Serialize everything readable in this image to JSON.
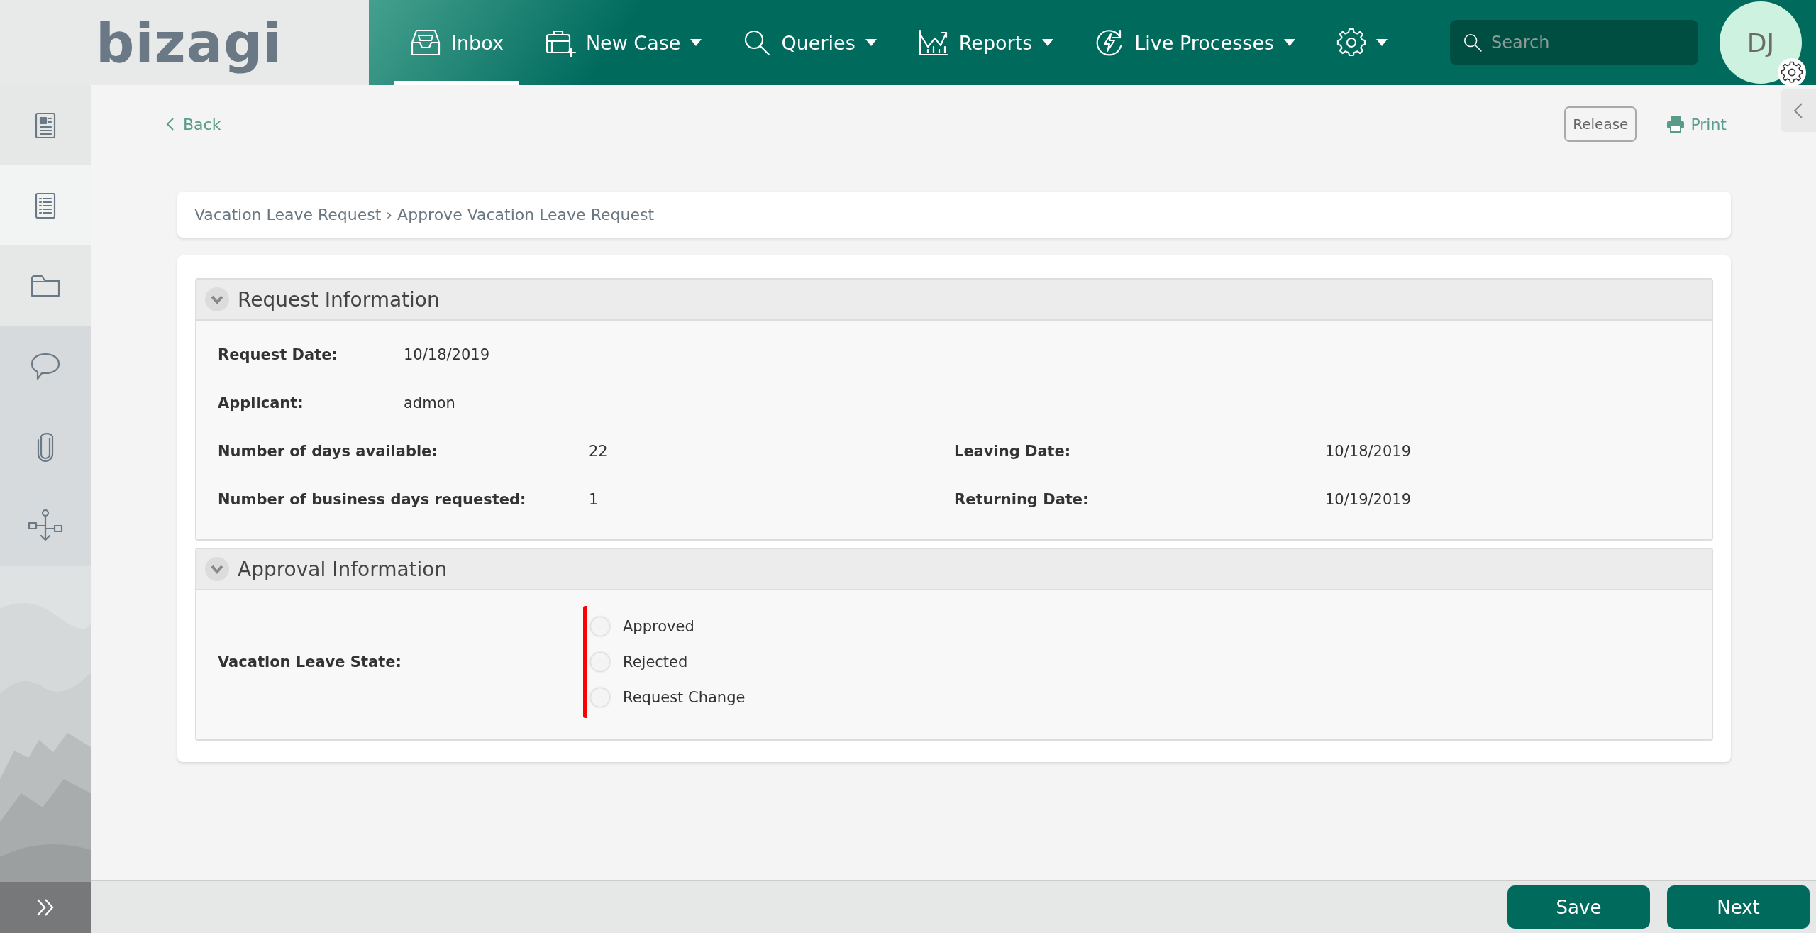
{
  "topbar": {
    "logo": "bizagi",
    "nav": [
      {
        "kind": "inbox",
        "label": "Inbox",
        "selected": true,
        "dropdown": false
      },
      {
        "kind": "new-case",
        "label": "New Case",
        "selected": false,
        "dropdown": true
      },
      {
        "kind": "search",
        "label": "Queries",
        "selected": false,
        "dropdown": true
      },
      {
        "kind": "chart",
        "label": "Reports",
        "selected": false,
        "dropdown": true
      },
      {
        "kind": "bolt",
        "label": "Live Processes",
        "selected": false,
        "dropdown": true
      },
      {
        "kind": "gear",
        "selected": false,
        "dropdown": true
      }
    ],
    "search": {
      "placeholder": "Search"
    },
    "avatar": {
      "initials": "DJ"
    }
  },
  "sidebar": {
    "primary": [
      {
        "kind": "form",
        "selected": false
      },
      {
        "kind": "list",
        "selected": true
      },
      {
        "kind": "folder",
        "selected": false
      }
    ],
    "secondary": [
      {
        "kind": "comment",
        "selected": false
      },
      {
        "kind": "clip",
        "selected": false
      },
      {
        "kind": "flow",
        "selected": false
      }
    ]
  },
  "toolbar": {
    "back": "Back",
    "release": "Release",
    "print": "Print"
  },
  "breadcrumb": "Vacation Leave Request › Approve Vacation Leave Request",
  "sections": [
    {
      "title": "Request Information",
      "expanded": true,
      "rows": [
        [
          {
            "kind": "text",
            "label": "Request Date:",
            "value": "10/18/2019"
          }
        ],
        [
          {
            "kind": "text",
            "label": "Applicant:",
            "value": "admon"
          }
        ],
        [
          {
            "kind": "text",
            "label": "Number of days available:",
            "value": "22"
          },
          {
            "kind": "text",
            "label": "Leaving Date:",
            "value": "10/18/2019"
          }
        ],
        [
          {
            "kind": "text",
            "label": "Number of business days requested:",
            "value": "1"
          },
          {
            "kind": "text",
            "label": "Returning Date:",
            "value": "10/19/2019"
          }
        ]
      ]
    },
    {
      "title": "Approval Information",
      "expanded": true,
      "rows": [
        [
          {
            "kind": "radio",
            "label": "Vacation Leave State:",
            "required": true,
            "options": [
              {
                "label": "Approved",
                "selected": false
              },
              {
                "label": "Rejected",
                "selected": false
              },
              {
                "label": "Request Change",
                "selected": false
              }
            ]
          }
        ]
      ]
    }
  ],
  "footer": {
    "buttons": [
      "Save",
      "Next"
    ]
  }
}
